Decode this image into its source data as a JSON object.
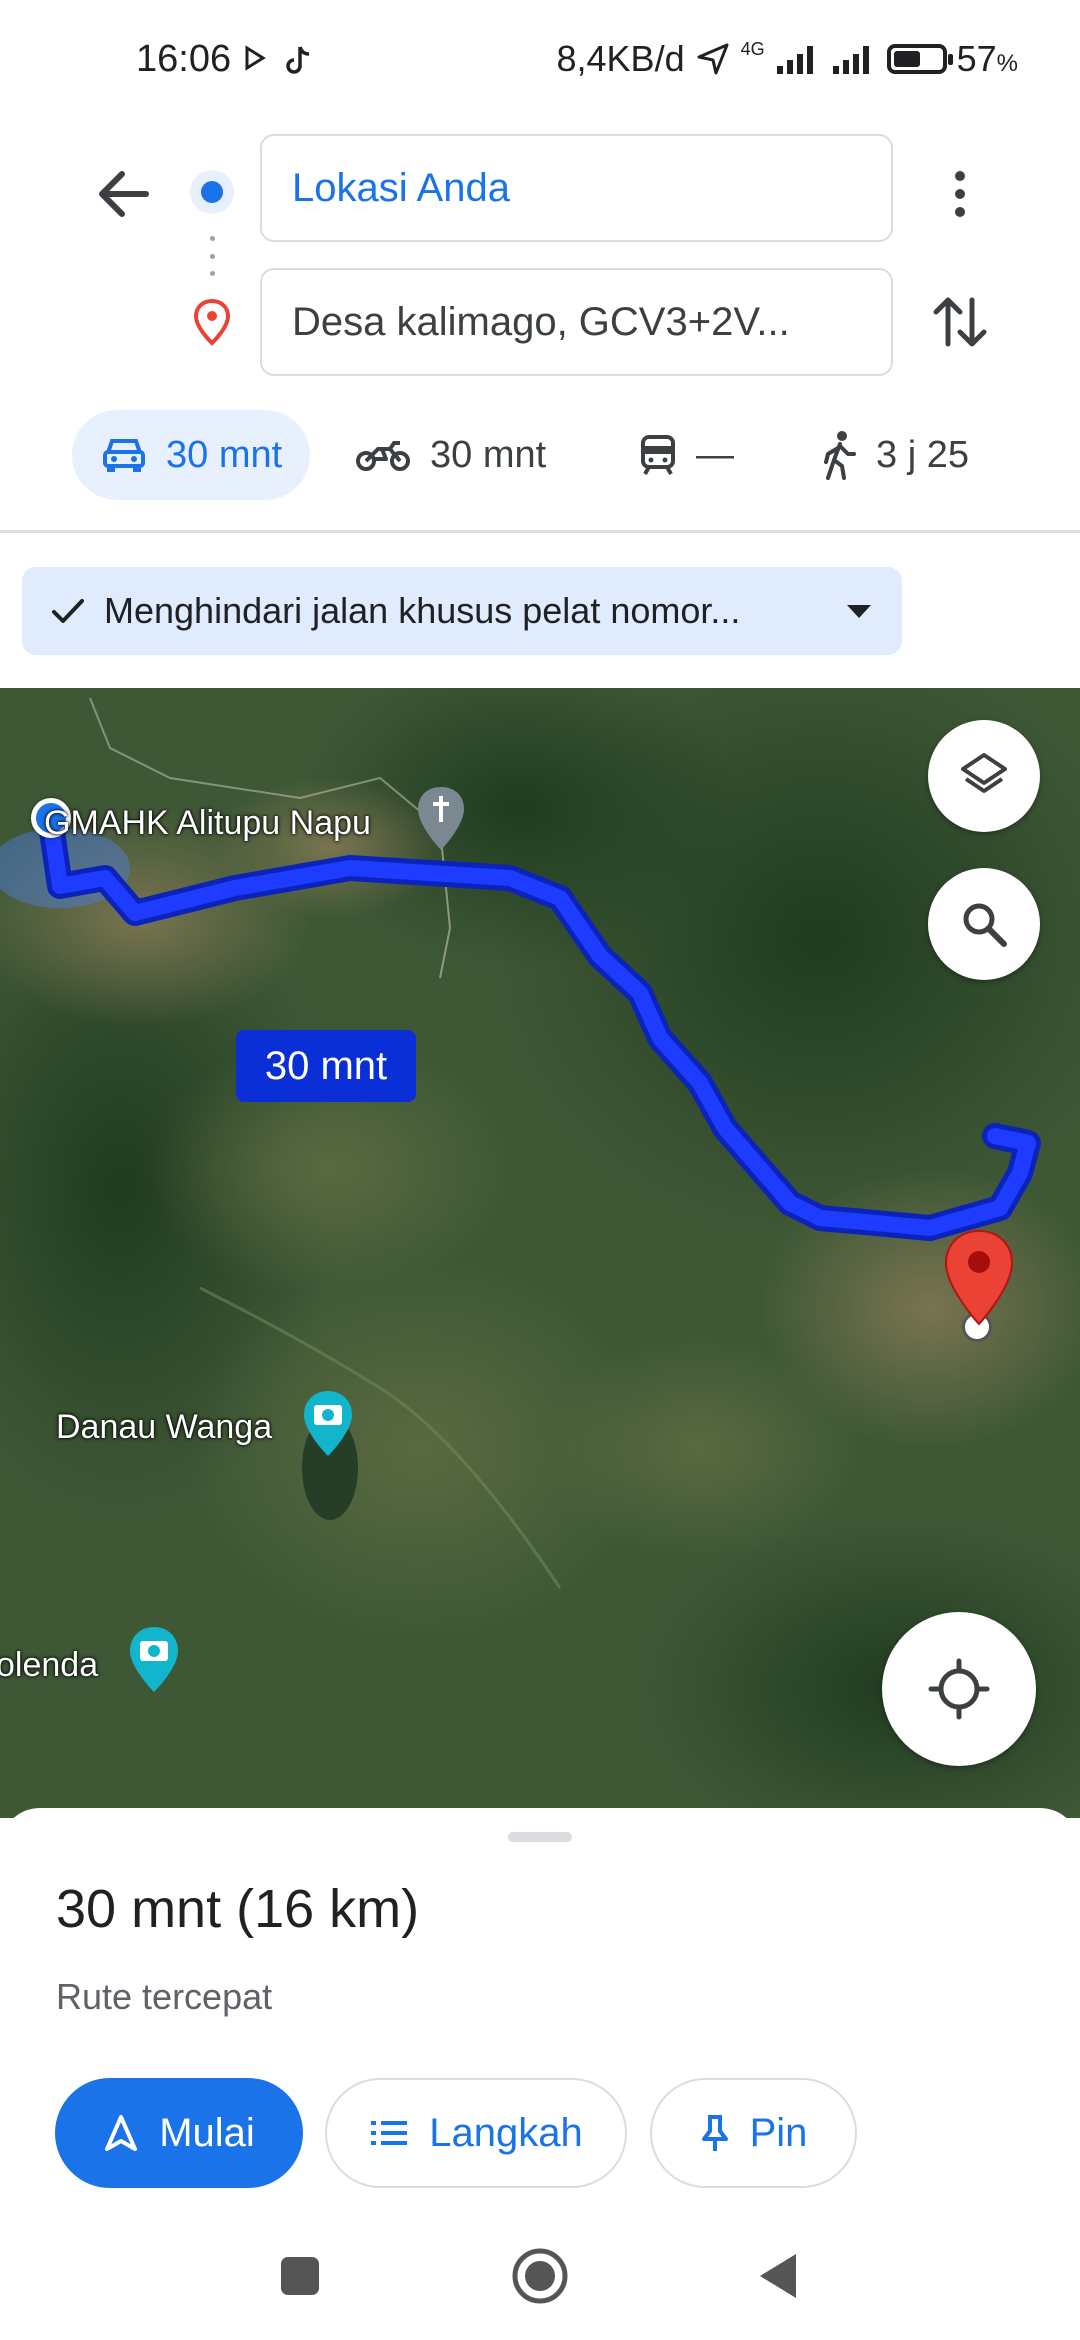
{
  "status_bar": {
    "time": "16:06",
    "network_speed": "8,4KB/d",
    "network_type": "4G",
    "battery_percent": "57",
    "battery_unit": "%",
    "battery_level": 0.57
  },
  "search": {
    "origin": "Lokasi Anda",
    "destination": "Desa kalimago, GCV3+2V..."
  },
  "modes": [
    {
      "icon": "car-icon",
      "label": "30 mnt",
      "active": true
    },
    {
      "icon": "motorcycle-icon",
      "label": "30 mnt",
      "active": false
    },
    {
      "icon": "train-icon",
      "label": "—",
      "active": false
    },
    {
      "icon": "walk-icon",
      "label": "3 j 25",
      "active": false
    }
  ],
  "option_chip": "Menghindari jalan khusus pelat nomor...",
  "map": {
    "places": [
      {
        "name": "GMAHK Alitupu Napu",
        "icon": "church-icon"
      },
      {
        "name": "Danau Wanga",
        "icon": "camera-icon"
      },
      {
        "name": "olenda",
        "icon": "camera-icon"
      }
    ],
    "route_eta": "30 mnt",
    "colors": {
      "route": "#1e3cff",
      "eta_bubble": "#0b2fd6",
      "dest_pin": "#ea4335",
      "origin": "#1a73e8"
    }
  },
  "sheet": {
    "title": "30 mnt (16 km)",
    "subtitle": "Rute tercepat",
    "buttons": {
      "start": "Mulai",
      "steps": "Langkah",
      "pin": "Pin"
    }
  }
}
